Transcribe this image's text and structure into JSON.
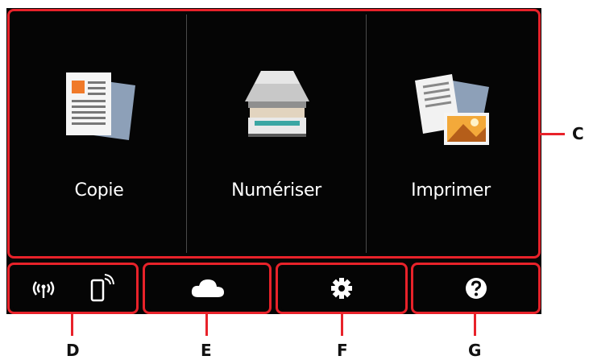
{
  "main_buttons": [
    {
      "label": "Copie",
      "icon": "copy-document-icon"
    },
    {
      "label": "Numériser",
      "icon": "scanner-icon"
    },
    {
      "label": "Imprimer",
      "icon": "print-photo-icon"
    }
  ],
  "bottom_buttons": [
    {
      "icon": "wireless-status-icon",
      "icon2": "smartphone-connect-icon"
    },
    {
      "icon": "cloud-icon"
    },
    {
      "icon": "settings-gear-icon"
    },
    {
      "icon": "help-question-icon"
    }
  ],
  "callouts": {
    "c": "C",
    "d": "D",
    "e": "E",
    "f": "F",
    "g": "G"
  },
  "colors": {
    "highlight": "#e8222a",
    "panel": "#050505",
    "text": "#ffffff"
  }
}
